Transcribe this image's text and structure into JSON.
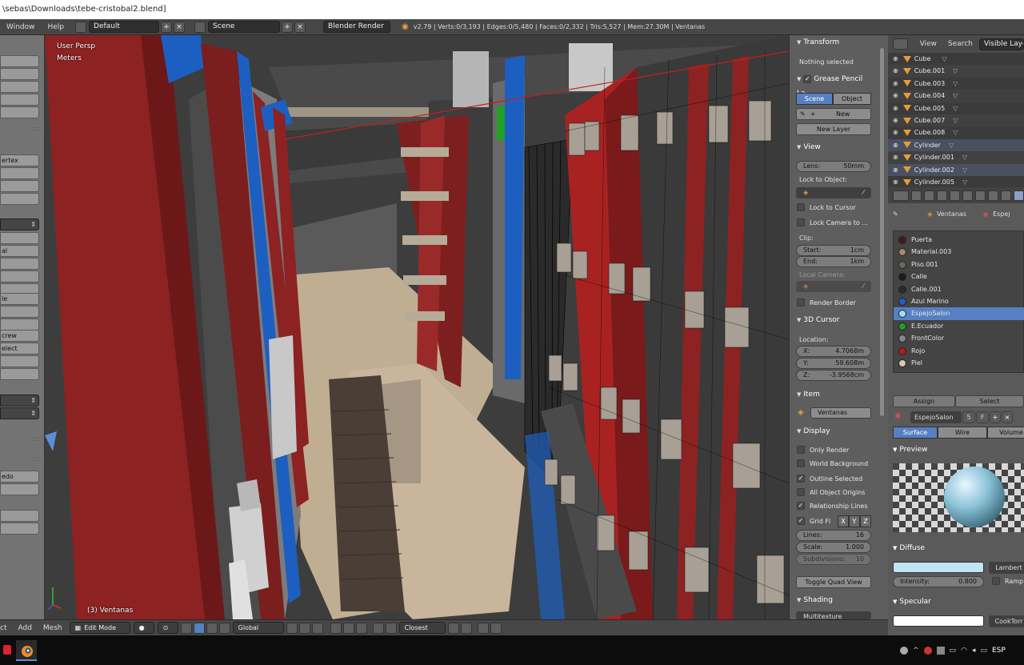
{
  "window": {
    "title": "\\sebas\\Downloads\\tebe-cristobal2.blend]"
  },
  "infobar": {
    "menus": [
      "Window",
      "Help"
    ],
    "layout": "Default",
    "scene": "Scene",
    "engine": "Blender Render",
    "stats": "v2.79 | Verts:0/3,193 | Edges:0/5,480 | Faces:0/2,332 | Tris:5,527 | Mem:27.30M | Ventanas"
  },
  "toolshelf": {
    "labels": [
      "ertex",
      "al",
      "le",
      "crew",
      "elect",
      "edo"
    ]
  },
  "viewport": {
    "view_label": "User Persp",
    "units_label": "Meters",
    "object_label": "(3) Ventanas"
  },
  "npanel": {
    "transform": {
      "header": "Transform",
      "status": "Nothing selected"
    },
    "grease": {
      "header": "Grease Pencil La",
      "tab_scene": "Scene",
      "tab_object": "Object",
      "new_label": "New",
      "new_layer": "New Layer"
    },
    "view": {
      "header": "View",
      "lens_label": "Lens:",
      "lens_value": "50mm",
      "lock_object_label": "Lock to Object:",
      "lock_cursor": "Lock to Cursor",
      "lock_camera": "Lock Camera to ...",
      "clip_label": "Clip:",
      "clip_start_label": "Start:",
      "clip_start_value": "1cm",
      "clip_end_label": "End:",
      "clip_end_value": "1km",
      "local_camera_label": "Local Camera:",
      "render_border": "Render Border"
    },
    "cursor": {
      "header": "3D Cursor",
      "location_label": "Location:",
      "x_label": "X:",
      "x_value": "4.7068m",
      "y_label": "Y:",
      "y_value": "59.608m",
      "z_label": "Z:",
      "z_value": "-3.9568cm"
    },
    "item": {
      "header": "Item",
      "name": "Ventanas"
    },
    "display": {
      "header": "Display",
      "only_render": "Only Render",
      "world_background": "World Background",
      "outline_selected": "Outline Selected",
      "all_object_origins": "All Object Origins",
      "relationship_lines": "Relationship Lines",
      "grid_floor": "Grid Fl",
      "axis_x": "X",
      "axis_y": "Y",
      "axis_z": "Z",
      "lines_label": "Lines:",
      "lines_value": "16",
      "scale_label": "Scale:",
      "scale_value": "1.000",
      "subdiv_label": "Subdivisions:",
      "subdiv_value": "10",
      "toggle_quad": "Toggle Quad View"
    },
    "shading": {
      "header": "Shading",
      "mode": "Multitexture"
    }
  },
  "outliner": {
    "menus": [
      "View",
      "Search"
    ],
    "filter": "Visible Layers",
    "items": [
      "Cube",
      "Cube.001",
      "Cube.003",
      "Cube.004",
      "Cube.005",
      "Cube.007",
      "Cube.008",
      "Cylinder",
      "Cylinder.001",
      "Cylinder.002",
      "Cylinder.005"
    ]
  },
  "properties": {
    "breadcrumb_object": "Ventanas",
    "breadcrumb_material": "Espej",
    "materials": [
      {
        "name": "Puerta",
        "color": "#4a1a14"
      },
      {
        "name": "Material.003",
        "color": "#a08a6a"
      },
      {
        "name": "Piso.001",
        "color": "#6d6558"
      },
      {
        "name": "Calle",
        "color": "#1c1c1c"
      },
      {
        "name": "Calle.001",
        "color": "#2a2a2a"
      },
      {
        "name": "Azul Marino",
        "color": "#1f5fbf"
      },
      {
        "name": "EspejoSalon",
        "color": "#a8d8f0"
      },
      {
        "name": "E.Ecuador",
        "color": "#20a020"
      },
      {
        "name": "FrontColor",
        "color": "#888888"
      },
      {
        "name": "Rojo",
        "color": "#b01c1c"
      },
      {
        "name": "Piel",
        "color": "#d8c8b0"
      }
    ],
    "assign": "Assign",
    "select": "Select",
    "material_name": "EspejoSalon",
    "users_label": "5",
    "fake_label": "F",
    "tab_surface": "Surface",
    "tab_wire": "Wire",
    "tab_volume": "Volume",
    "preview_header": "Preview",
    "diffuse_header": "Diffuse",
    "diffuse_color": "#bfe4f5",
    "diffuse_shader": "Lambert",
    "intensity_label": "Intensity:",
    "intensity_value": "0.800",
    "ramp_label": "Ramp",
    "specular_header": "Specular",
    "specular_shader": "CookTorr"
  },
  "bottombar": {
    "menus": [
      "ct",
      "Add",
      "Mesh"
    ],
    "mode": "Edit Mode",
    "orientation": "Global",
    "snap": "Closest"
  },
  "taskbar": {
    "lang": "ESP"
  }
}
